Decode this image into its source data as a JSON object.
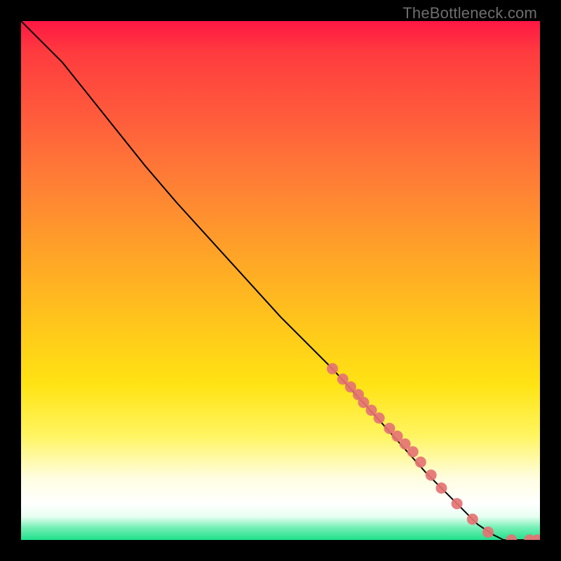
{
  "watermark": "TheBottleneck.com",
  "chart_data": {
    "type": "line",
    "title": "",
    "xlabel": "",
    "ylabel": "",
    "xlim": [
      0,
      100
    ],
    "ylim": [
      0,
      100
    ],
    "grid": false,
    "legend": false,
    "series": [
      {
        "name": "curve",
        "style": "line",
        "color": "#000000",
        "x": [
          0,
          4,
          8,
          12,
          16,
          20,
          24,
          30,
          40,
          50,
          60,
          70,
          78,
          84,
          88,
          91,
          93,
          98,
          100
        ],
        "y": [
          100,
          96,
          92,
          87,
          82,
          77,
          72,
          65,
          54,
          43,
          33,
          22,
          13,
          7,
          3,
          1,
          0,
          0,
          0
        ]
      },
      {
        "name": "scatter-points",
        "style": "scatter",
        "color": "#e57373",
        "x": [
          60,
          62,
          63.5,
          65,
          66,
          67.5,
          69,
          71,
          72.5,
          74,
          75.5,
          77,
          79,
          81,
          84,
          87,
          90,
          94.5,
          98,
          99.5
        ],
        "y": [
          33,
          31,
          29.5,
          28,
          26.5,
          25,
          23.5,
          21.5,
          20,
          18.5,
          17,
          15,
          12.5,
          10,
          7,
          4,
          1.5,
          0,
          0,
          0
        ]
      }
    ]
  }
}
